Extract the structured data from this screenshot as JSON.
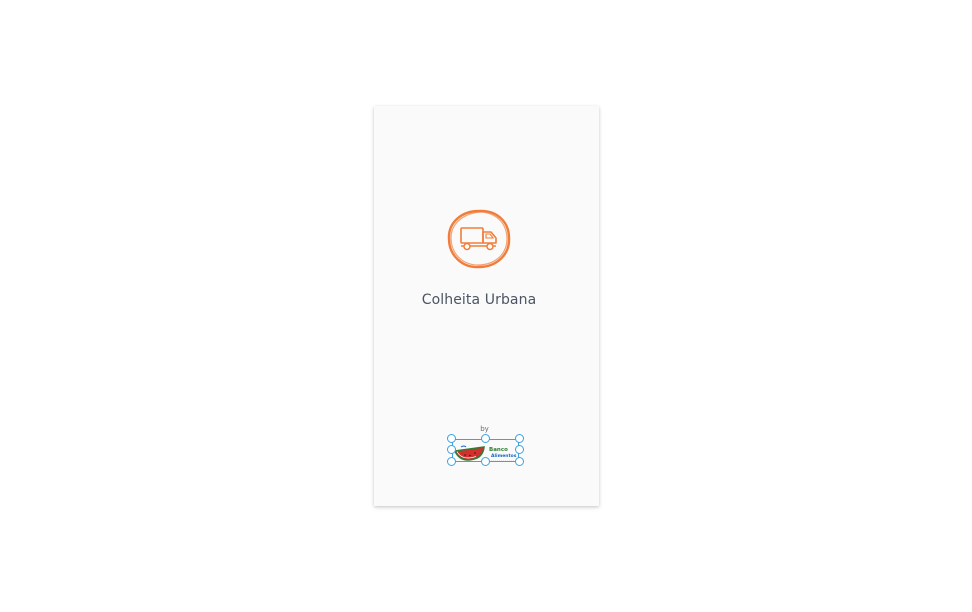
{
  "splash": {
    "app_name": "Colheita Urbana",
    "app_icon": "delivery-truck-icon",
    "by_label": "by",
    "sponsor": {
      "logo_icon": "banco-de-alimentos-logo",
      "logo_text_line1": "Banco",
      "logo_text_line2": "Alimentos"
    }
  },
  "colors": {
    "accent": "#f07e3a",
    "text": "#4b5563",
    "selection": "#3aa3e3",
    "logo_red": "#d32f2f",
    "logo_green": "#2e7d32",
    "logo_blue": "#1565c0"
  }
}
